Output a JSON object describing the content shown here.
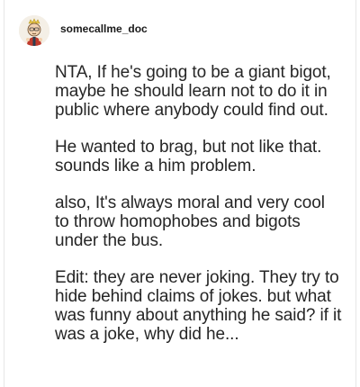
{
  "post": {
    "username": "somecallme_doc",
    "avatar_icon": "cartoon-avatar-icon",
    "paragraphs": [
      "NTA, If he's going to be a giant bigot, maybe he should learn not to do it in public where anybody could find out.",
      "He wanted to brag, but not like that. sounds like a him problem.",
      "also, It's always moral and very cool to throw homophobes and bigots under the bus.",
      "Edit: they are never joking. They try to hide behind claims of jokes. but what was funny about anything he said? if it was a joke, why did he..."
    ]
  }
}
